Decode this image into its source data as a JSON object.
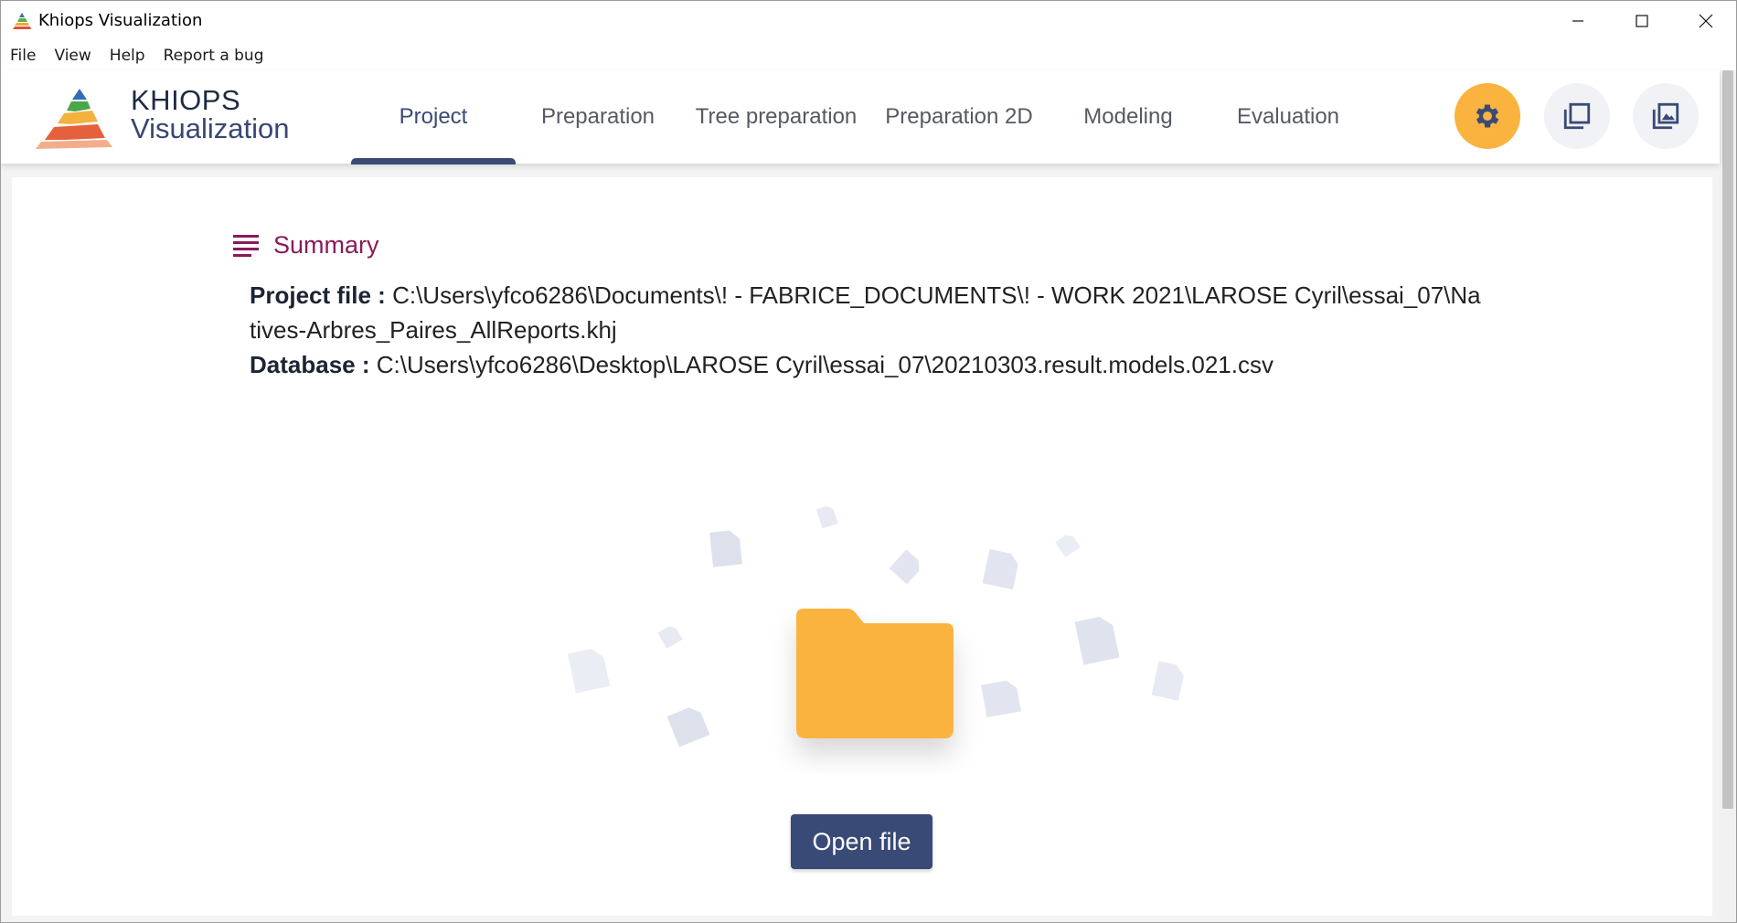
{
  "window": {
    "title": "Khiops Visualization"
  },
  "menu": {
    "items": [
      {
        "label": "File"
      },
      {
        "label": "View"
      },
      {
        "label": "Help"
      },
      {
        "label": "Report a bug"
      }
    ]
  },
  "header": {
    "logo_line1": "KHIOPS",
    "logo_line2": "Visualization",
    "tabs": [
      {
        "label": "Project",
        "active": true
      },
      {
        "label": "Preparation",
        "active": false
      },
      {
        "label": "Tree preparation",
        "active": false
      },
      {
        "label": "Preparation 2D",
        "active": false
      },
      {
        "label": "Modeling",
        "active": false
      },
      {
        "label": "Evaluation",
        "active": false
      }
    ],
    "icons": [
      "gear-icon",
      "copy-icon",
      "image-gallery-icon"
    ]
  },
  "summary": {
    "title": "Summary",
    "project_file_label": "Project file :",
    "project_file_value": "C:\\Users\\yfco6286\\Documents\\! - FABRICE_DOCUMENTS\\! - WORK 2021\\LAROSE Cyril\\essai_07\\Natives-Arbres_Paires_AllReports.khj",
    "database_label": "Database :",
    "database_value": "C:\\Users\\yfco6286\\Desktop\\LAROSE Cyril\\essai_07\\20210303.result.models.021.csv"
  },
  "actions": {
    "open_file_label": "Open file"
  },
  "colors": {
    "accent": "#3a4a76",
    "settings": "#fbb33f",
    "summary_title": "#8a1a5a",
    "folder": "#fbb33f"
  }
}
